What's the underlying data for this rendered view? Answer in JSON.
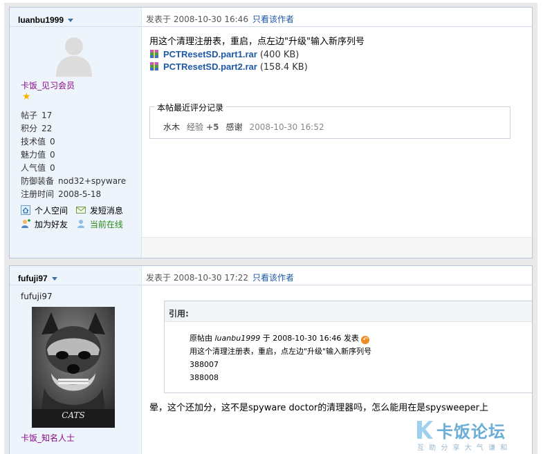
{
  "post1": {
    "username": "luanbu1999",
    "rank": "卡饭_见习会员",
    "stats": [
      {
        "label": "帖子",
        "value": "17"
      },
      {
        "label": "积分",
        "value": "22"
      },
      {
        "label": "技术值",
        "value": "0"
      },
      {
        "label": "魅力值",
        "value": "0"
      },
      {
        "label": "人气值",
        "value": "0"
      },
      {
        "label": "防御装备",
        "value": "nod32+spyware"
      },
      {
        "label": "注册时间",
        "value": "2008-5-18"
      }
    ],
    "actions": {
      "space": "个人空间",
      "message": "发短消息",
      "add_friend": "加为好友",
      "online": "当前在线"
    },
    "header": {
      "posted": "发表于 2008-10-30 16:46",
      "only_author": "只看该作者"
    },
    "body_text": "用这个清理注册表，重启，点左边\"升级\"输入新序列号",
    "attachments": [
      {
        "name": "PCTResetSD.part1.rar",
        "size": "(400 KB)"
      },
      {
        "name": "PCTResetSD.part2.rar",
        "size": "(158.4 KB)"
      }
    ],
    "rating": {
      "legend": "本帖最近评分记录",
      "user": "水木",
      "type": "经验",
      "points": "+5",
      "reason": "感谢",
      "time": "2008-10-30 16:52"
    }
  },
  "post2": {
    "username": "fufuji97",
    "nickname": "fufuji97",
    "rank": "卡饭_知名人士",
    "avatar_caption": "CATS",
    "header": {
      "posted": "发表于 2008-10-30 17:22",
      "only_author": "只看该作者"
    },
    "quote": {
      "title": "引用:",
      "prefix": "原帖由",
      "author": "luanbu1999",
      "meta": "于 2008-10-30 16:46 发表",
      "lines": [
        "用这个清理注册表，重启，点左边\"升级\"输入新序列号",
        "388007",
        "388008"
      ]
    },
    "reply": "晕，这个还加分，这不是spyware doctor的清理器吗，怎么能用在是spysweeper上"
  },
  "watermark": {
    "title": "卡饭论坛",
    "subtitle": "互 助 分 享    大 气 谦 和"
  },
  "colors": {
    "sidebar_bg": "#eef4fb",
    "border": "#b7c5d6",
    "link_blue": "#1d58a7",
    "rank_purple": "#8a0a8a",
    "online_green": "#2a8a1a"
  }
}
